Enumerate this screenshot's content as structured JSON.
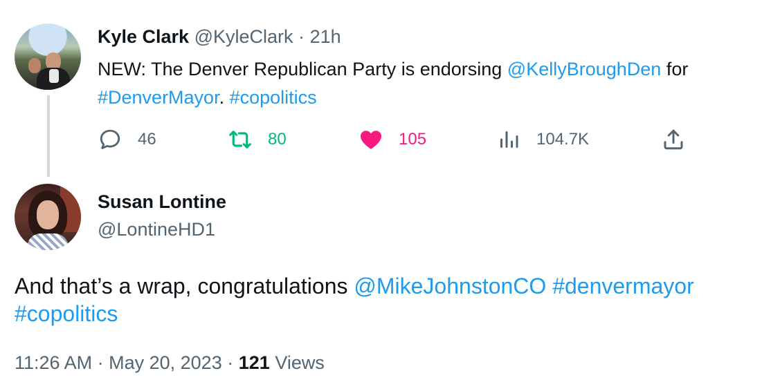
{
  "parent_tweet": {
    "avatar_alt": "Kyle Clark avatar",
    "display_name": "Kyle Clark",
    "handle": "@KyleClark",
    "separator": "·",
    "time": "21h",
    "text_parts": {
      "intro": "NEW: The Denver Republican Party is endorsing ",
      "mention": "@KellyBroughDen",
      "after_mention": " for ",
      "hashtag1": "#DenverMayor",
      "between": ". ",
      "hashtag2": "#copolitics"
    },
    "actions": {
      "reply_count": "46",
      "retweet_count": "80",
      "like_count": "105",
      "view_count": "104.7K"
    },
    "icons": {
      "reply": "reply-icon",
      "retweet": "retweet-icon",
      "like": "heart-icon",
      "views": "views-chart-icon",
      "share": "share-icon"
    },
    "colors": {
      "retweet": "#00ba7c",
      "like": "#f91880",
      "link": "#1d9bf0",
      "muted": "#536471"
    }
  },
  "reply_tweet": {
    "display_name": "Susan Lontine",
    "handle": "@LontineHD1",
    "text_parts": {
      "intro": "And that’s a wrap, congratulations ",
      "mention": "@MikeJohnstonCO",
      "space": " ",
      "hashtag1": "#denvermayor",
      "hashtag2": "#copolitics"
    },
    "meta": {
      "time": "11:26 AM",
      "separator": "·",
      "date": "May 20, 2023",
      "views_count": "121",
      "views_label": "Views"
    }
  }
}
